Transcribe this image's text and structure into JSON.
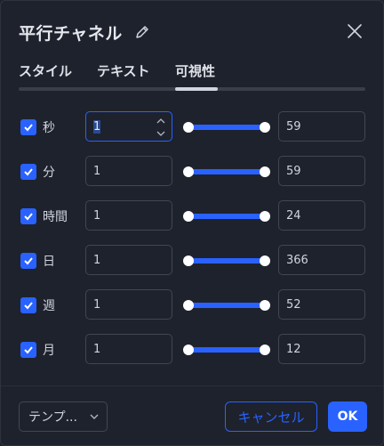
{
  "header": {
    "title": "平行チャネル"
  },
  "tabs": [
    {
      "label": "スタイル"
    },
    {
      "label": "テキスト"
    },
    {
      "label": "可視性",
      "active": true
    }
  ],
  "rows": [
    {
      "label": "秒",
      "checked": true,
      "min": "1",
      "max": "59"
    },
    {
      "label": "分",
      "checked": true,
      "min": "1",
      "max": "59"
    },
    {
      "label": "時間",
      "checked": true,
      "min": "1",
      "max": "24"
    },
    {
      "label": "日",
      "checked": true,
      "min": "1",
      "max": "366"
    },
    {
      "label": "週",
      "checked": true,
      "min": "1",
      "max": "52"
    },
    {
      "label": "月",
      "checked": true,
      "min": "1",
      "max": "12"
    }
  ],
  "footer": {
    "template_label": "テンプ...",
    "cancel_label": "キャンセル",
    "ok_label": "OK"
  },
  "colors": {
    "accent": "#2962ff",
    "background": "#1e222d",
    "border": "#434651",
    "text": "#d1d4dc"
  },
  "icons": [
    "pencil-icon",
    "close-icon",
    "checkmark-icon",
    "chevron-down-icon",
    "stepper-up-icon",
    "stepper-down-icon"
  ]
}
